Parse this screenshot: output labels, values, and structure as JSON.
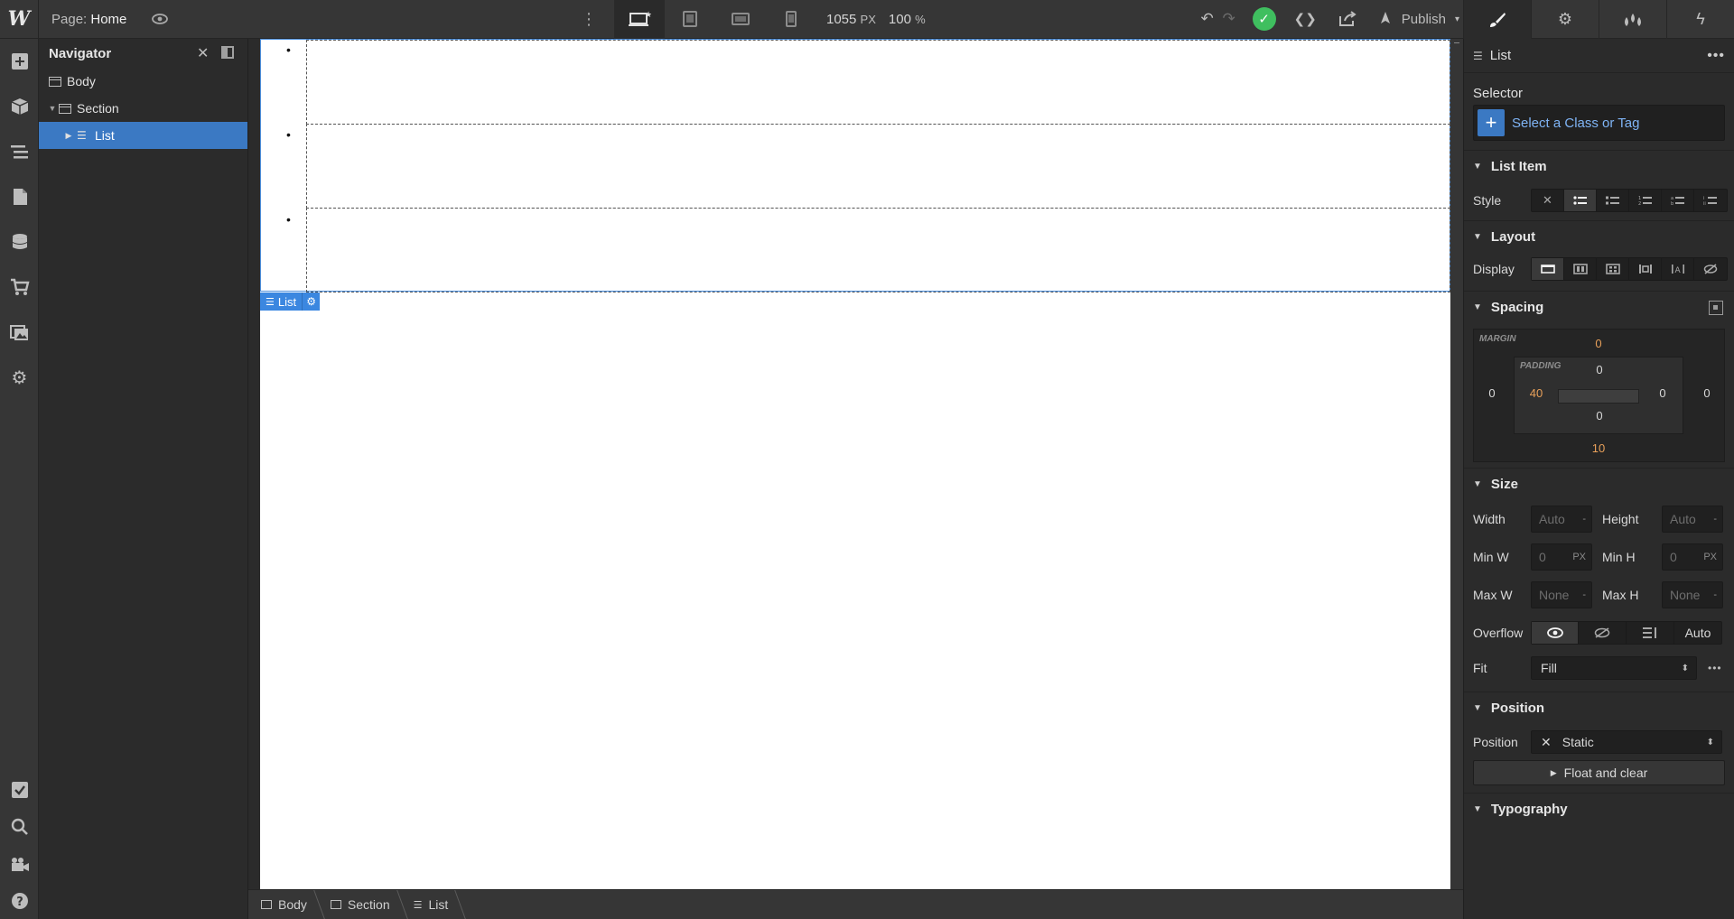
{
  "topbar": {
    "logo": "W",
    "page_prefix": "Page:",
    "page_name": "Home",
    "width_value": "1055",
    "width_unit": "PX",
    "zoom_value": "100",
    "zoom_unit": "%",
    "publish_label": "Publish",
    "active_device": "desktop"
  },
  "navigator": {
    "title": "Navigator",
    "tree": [
      {
        "label": "Body",
        "depth": 0,
        "selected": false
      },
      {
        "label": "Section",
        "depth": 1,
        "selected": false
      },
      {
        "label": "List",
        "depth": 2,
        "selected": true
      }
    ]
  },
  "canvas": {
    "bullet": "•",
    "list_items": 3,
    "selected_tag": "List"
  },
  "breadcrumbs": [
    "Body",
    "Section",
    "List"
  ],
  "panel": {
    "element_type": "List",
    "selector_label": "Selector",
    "selector_placeholder": "Select a Class or Tag",
    "list_item_section": "List Item",
    "style_label": "Style",
    "layout_section": "Layout",
    "display_label": "Display",
    "spacing_section": "Spacing",
    "margin_label": "MARGIN",
    "padding_label": "PADDING",
    "margin": {
      "top": "0",
      "right": "0",
      "bottom": "10",
      "left": "0"
    },
    "padding": {
      "top": "0",
      "right": "0",
      "bottom": "0",
      "left": "40"
    },
    "size_section": "Size",
    "width_label": "Width",
    "height_label": "Height",
    "min_w_label": "Min W",
    "min_h_label": "Min H",
    "max_w_label": "Max W",
    "max_h_label": "Max H",
    "width_value": "Auto",
    "height_value": "Auto",
    "min_w_value": "0",
    "min_h_value": "0",
    "max_w_value": "None",
    "max_h_value": "None",
    "unit_dash": "-",
    "unit_px": "PX",
    "overflow_label": "Overflow",
    "overflow_auto": "Auto",
    "fit_label": "Fit",
    "fit_value": "Fill",
    "position_section": "Position",
    "position_label": "Position",
    "position_value": "Static",
    "float_label": "Float and clear",
    "typography_section": "Typography"
  },
  "colors": {
    "accent": "#3b79c3",
    "publish_ok": "#3fbf5f",
    "orange_value": "#e8a05a",
    "link_blue": "#7fb4f5"
  }
}
